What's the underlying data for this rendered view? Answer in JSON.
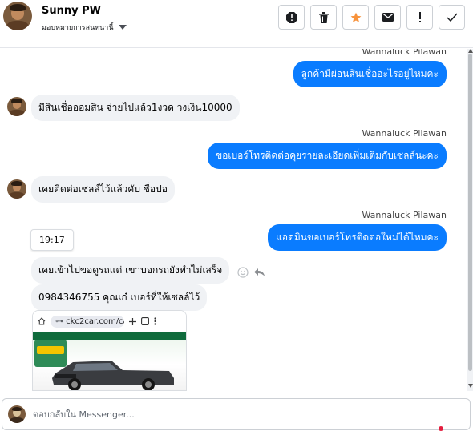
{
  "header": {
    "name": "Sunny PW",
    "assignee": "มอบหมายการสนทนานี้"
  },
  "toolbar": {
    "buttons": [
      "spam-report",
      "delete",
      "star",
      "email",
      "mark-important",
      "mark-done"
    ]
  },
  "messages": {
    "out1": {
      "sender": "Wannaluck Pilawan",
      "text": "ลูกค้ามีผ่อนสินเชื่ออะไรอยู่ไหมคะ"
    },
    "in1": {
      "text": "มีสินเชื่อออมสิน จ่ายไปแล้ว1งวด วงเงิน10000"
    },
    "out2": {
      "sender": "Wannaluck Pilawan",
      "text": "ขอเบอร์โทรติดต่อคุยรายละเอียดเพิ่มเติมกับเซลล์นะคะ"
    },
    "in2": {
      "text": "เคยติดต่อเซลล์ไว้แล้วคับ ชื่อปอ"
    },
    "out3": {
      "sender": "Wannaluck Pilawan",
      "text": "แอดมินขอเบอร์โทรติดต่อใหม่ได้ไหมคะ"
    },
    "time": "19:17",
    "in3": {
      "text": "เคยเข้าไปขอดูรถแต่ เขาบอกรถยังทำไม่เสร็จ"
    },
    "in4": {
      "text": "0984346755 คุณเก๋ เบอร์ที่ให้เซลล์ไว้"
    },
    "screenshot": {
      "url": "ckc2car.com/ca"
    }
  },
  "composer": {
    "placeholder": "ตอบกลับใน Messenger..."
  },
  "colors": {
    "accent": "#0a7cff",
    "star": "#f7923b",
    "incoming_bubble": "#f0f2f5"
  }
}
